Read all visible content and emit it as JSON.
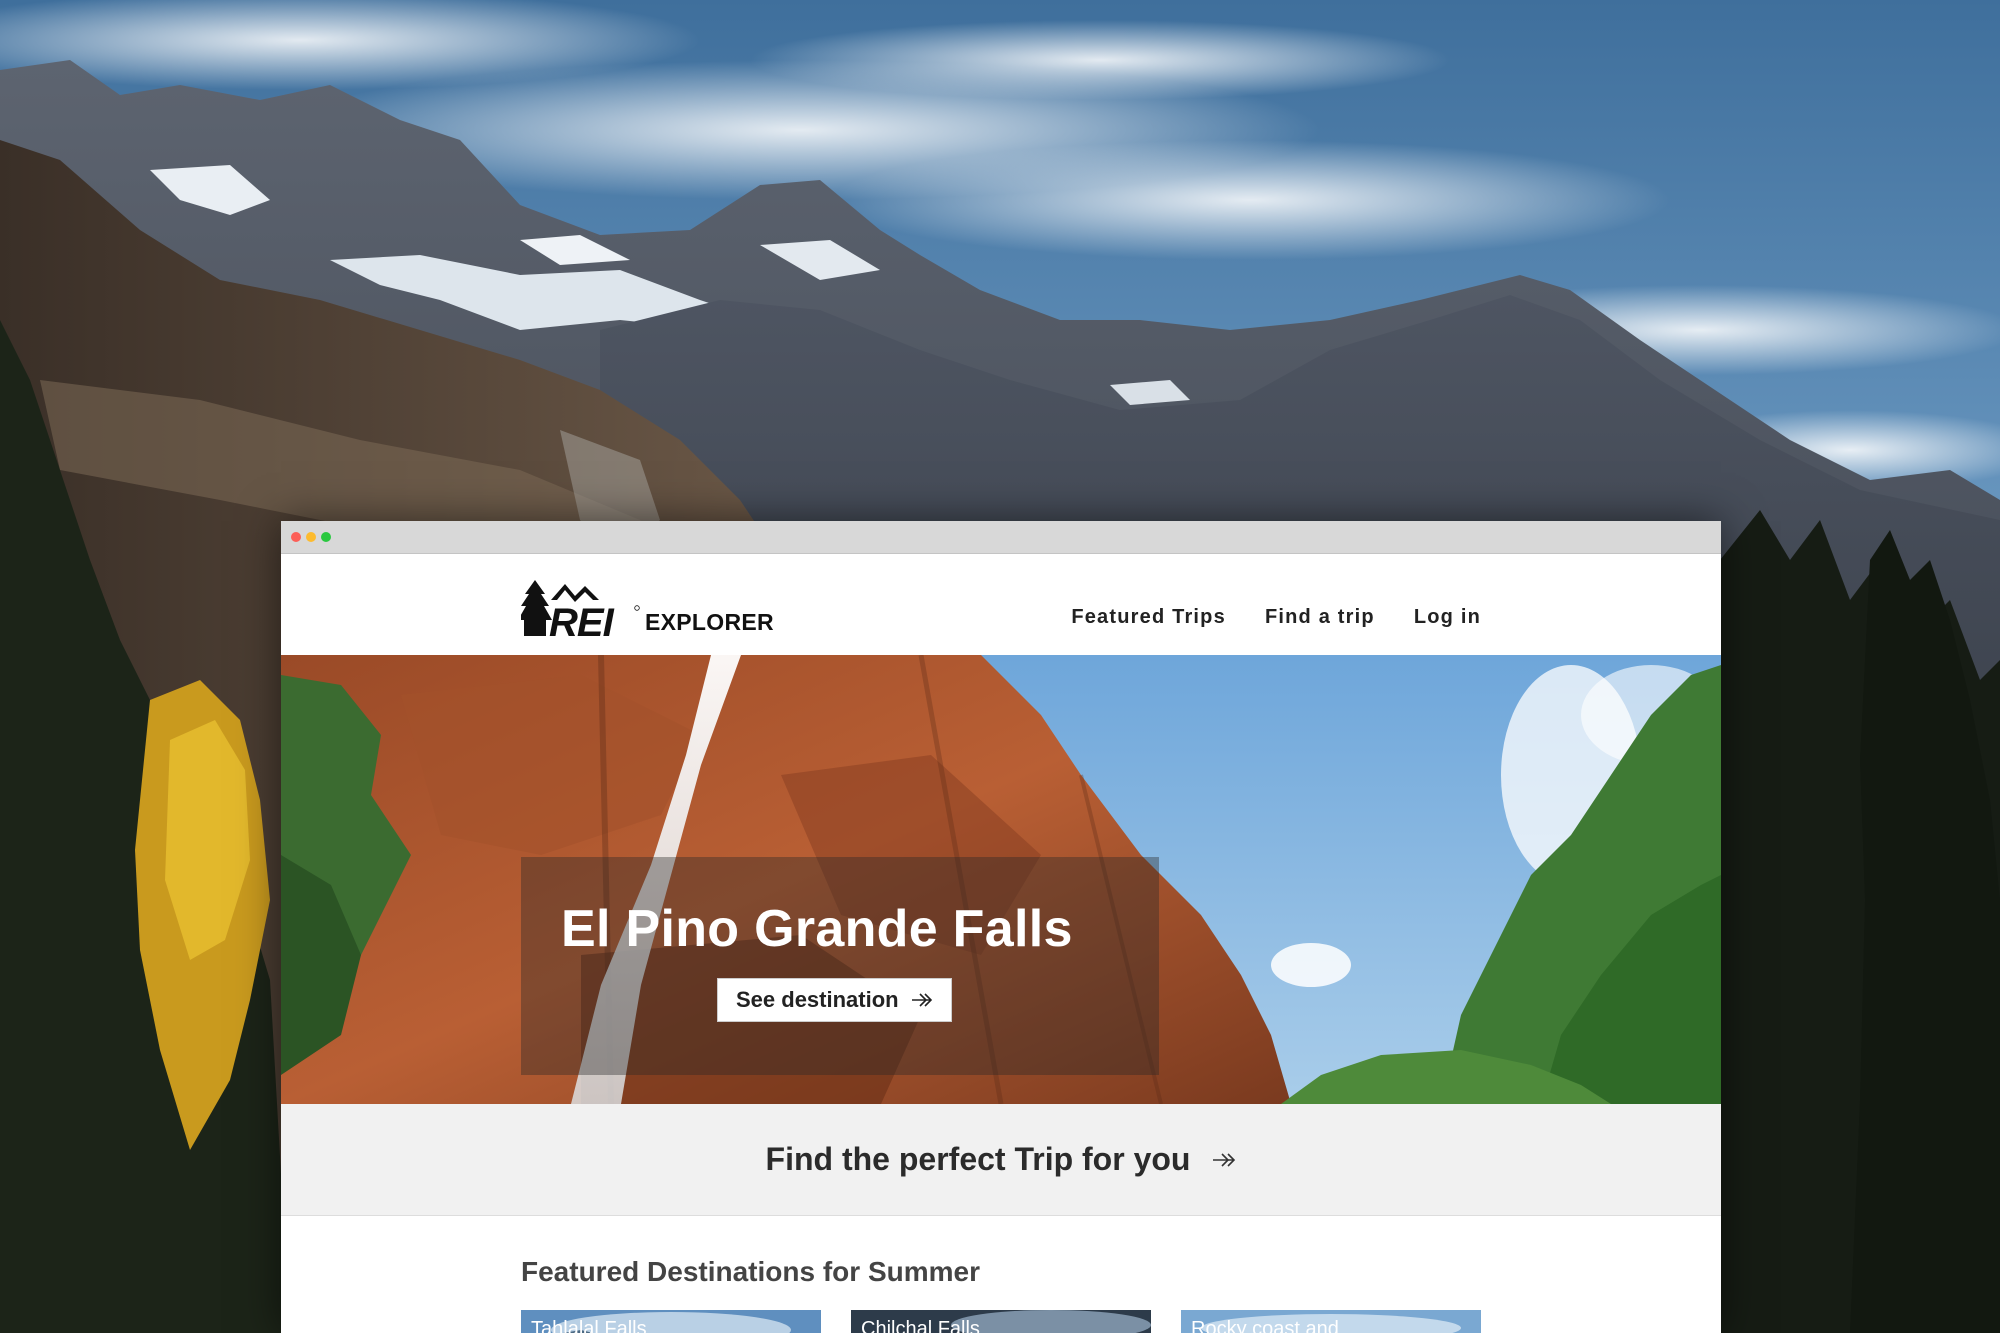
{
  "site": {
    "logo_text": "EXPLORER"
  },
  "nav": {
    "items": [
      {
        "label": "Featured Trips"
      },
      {
        "label": "Find a trip"
      },
      {
        "label": "Log in"
      }
    ]
  },
  "hero": {
    "title": "El Pino Grande Falls",
    "button_label": "See destination"
  },
  "cta": {
    "label": "Find the perfect Trip for you"
  },
  "featured": {
    "heading": "Featured Destinations for Summer",
    "cards": [
      {
        "label": "Tahlalal Falls"
      },
      {
        "label": "Chilchal Falls"
      },
      {
        "label": "Rocky coast and"
      }
    ]
  },
  "colors": {
    "window_chrome": "#d8d8d8",
    "cta_background": "#f1f1f1",
    "text_dark": "#222222"
  }
}
